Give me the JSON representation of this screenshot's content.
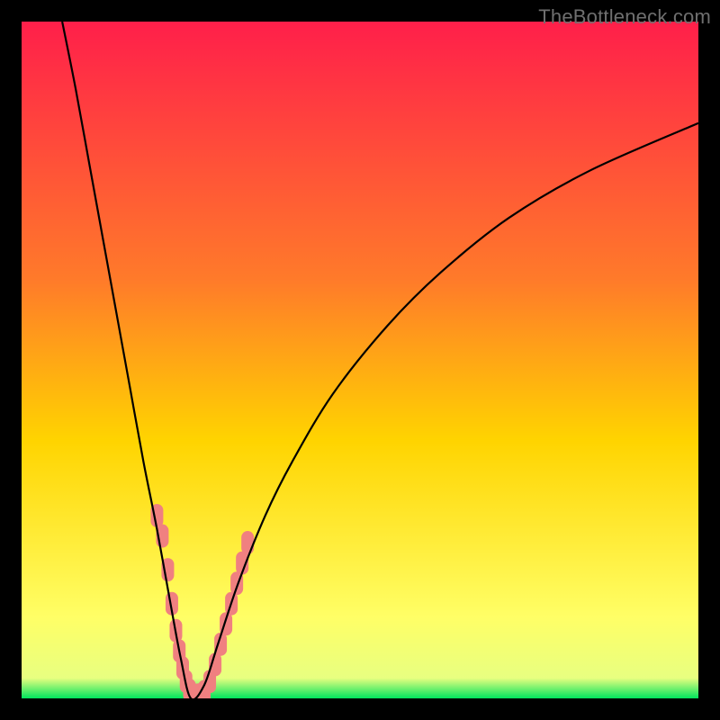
{
  "watermark": "TheBottleneck.com",
  "chart_data": {
    "type": "line",
    "title": "",
    "xlabel": "",
    "ylabel": "",
    "xlim": [
      0,
      100
    ],
    "ylim": [
      0,
      100
    ],
    "background_gradient": {
      "top_color": "#ff1f4a",
      "mid_color": "#ffd400",
      "bottom_color": "#00e35d",
      "bottom_band_height_pct": 3
    },
    "series": [
      {
        "name": "bottleneck-curve",
        "stroke": "#000000",
        "points": [
          {
            "x": 6.0,
            "y": 100.0
          },
          {
            "x": 8.0,
            "y": 90.0
          },
          {
            "x": 10.0,
            "y": 79.0
          },
          {
            "x": 12.0,
            "y": 68.0
          },
          {
            "x": 14.0,
            "y": 57.0
          },
          {
            "x": 16.0,
            "y": 46.0
          },
          {
            "x": 18.0,
            "y": 35.0
          },
          {
            "x": 20.0,
            "y": 25.0
          },
          {
            "x": 22.0,
            "y": 14.0
          },
          {
            "x": 23.5,
            "y": 6.0
          },
          {
            "x": 25.0,
            "y": 0.0
          },
          {
            "x": 27.0,
            "y": 2.0
          },
          {
            "x": 29.0,
            "y": 8.0
          },
          {
            "x": 32.0,
            "y": 17.0
          },
          {
            "x": 36.0,
            "y": 27.0
          },
          {
            "x": 40.0,
            "y": 35.0
          },
          {
            "x": 46.0,
            "y": 45.0
          },
          {
            "x": 54.0,
            "y": 55.0
          },
          {
            "x": 62.0,
            "y": 63.0
          },
          {
            "x": 72.0,
            "y": 71.0
          },
          {
            "x": 84.0,
            "y": 78.0
          },
          {
            "x": 100.0,
            "y": 85.0
          }
        ]
      }
    ],
    "markers": {
      "name": "product-cluster",
      "shape": "rounded-rect",
      "color": "#f08080",
      "points": [
        {
          "x": 20.0,
          "y": 27.0
        },
        {
          "x": 20.8,
          "y": 24.0
        },
        {
          "x": 21.6,
          "y": 19.0
        },
        {
          "x": 22.2,
          "y": 14.0
        },
        {
          "x": 22.8,
          "y": 10.0
        },
        {
          "x": 23.3,
          "y": 7.0
        },
        {
          "x": 23.8,
          "y": 4.5
        },
        {
          "x": 24.3,
          "y": 2.5
        },
        {
          "x": 24.8,
          "y": 1.2
        },
        {
          "x": 25.5,
          "y": 0.5
        },
        {
          "x": 26.2,
          "y": 0.5
        },
        {
          "x": 27.0,
          "y": 1.0
        },
        {
          "x": 27.8,
          "y": 2.5
        },
        {
          "x": 28.6,
          "y": 5.0
        },
        {
          "x": 29.4,
          "y": 8.0
        },
        {
          "x": 30.2,
          "y": 11.0
        },
        {
          "x": 31.0,
          "y": 14.0
        },
        {
          "x": 31.8,
          "y": 17.0
        },
        {
          "x": 32.6,
          "y": 20.0
        },
        {
          "x": 33.4,
          "y": 23.0
        }
      ]
    }
  }
}
